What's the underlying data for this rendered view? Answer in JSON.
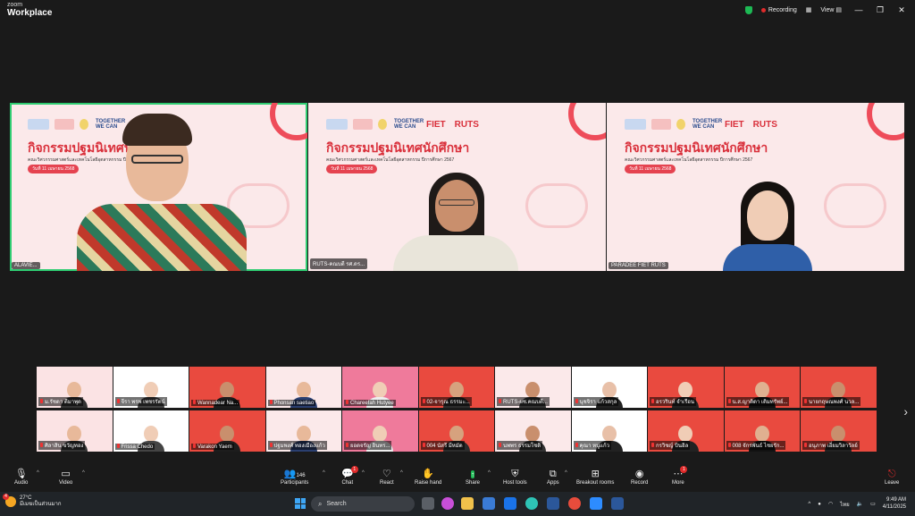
{
  "window": {
    "brand_line1": "zoom",
    "brand_line2": "Workplace",
    "recording_label": "Recording",
    "view_label": "View"
  },
  "slide": {
    "title": "กิจกรรมปฐมนิเทศนักศึกษา",
    "subtitle": "คณะวิศวกรรมศาสตร์และเทคโนโลยีอุตสาหกรรม ปีการศึกษา 2567",
    "date": "วันที่ 11 เมษายน 2568",
    "logo_together": "TOGETHER WE CAN",
    "logo_fiet": "FIET",
    "logo_ruts": "RUTS"
  },
  "stage": [
    {
      "name": "ALAVIE..."
    },
    {
      "name": "RUTS-คณบดี รศ.ดร..."
    },
    {
      "name": "PARADEE FIET RUTS"
    }
  ],
  "gallery_row1": [
    "ม.รัชดา ดีมาพุด",
    "จีรา พรพ เพชรรัตน์",
    "Wannadear Na...",
    "Phonsan saetiao",
    "Chareefah Hutyee",
    "02-จารุณ ธรรมะ...",
    "RUTS-ผช.คณบดี...",
    "นุชจิรา แก้วสกุล",
    "อรวรินท์ จำเรือน",
    "น.ส.ญาติดา เติมทรัพย์...",
    "นายกฤษณพงศ์ นวล..."
  ],
  "gallery_row2": [
    "ศิลาสิน ขวัญทอง",
    "Frissa Chedo",
    "Varakon Yaem",
    "ปฐมพงศ์ ทองเมืองแก้ว",
    "ยอดจรัญ อินทร...",
    "004 นัสรี มีหมัด",
    "นพพร ธรรมโชติ",
    "คุณา หนูแก้ว",
    "กรวิชญ์ บินอิล",
    "008 จักรพันธ์ ไชยรัก...",
    "อนุภาพ เอี่ยมวิลาวัลย์"
  ],
  "toolbar": {
    "audio": "Audio",
    "video": "Video",
    "participants": "Participants",
    "participants_count": "146",
    "chat": "Chat",
    "chat_badge": "1",
    "react": "React",
    "raise_hand": "Raise hand",
    "share": "Share",
    "host_tools": "Host tools",
    "apps": "Apps",
    "breakout_rooms": "Breakout rooms",
    "record": "Record",
    "more": "More",
    "more_badge": "1",
    "leave": "Leave"
  },
  "taskbar": {
    "weather_badge": "4",
    "temperature": "27°C",
    "weather_desc": "มีเมฆเป็นส่วนมาก",
    "search_placeholder": "Search",
    "lang": "ไทย",
    "time": "9:49 AM",
    "date": "4/11/2025"
  },
  "colors": {
    "accent_red": "#d9303b",
    "active_speaker": "#2ecc71",
    "share_green": "#1db954"
  }
}
